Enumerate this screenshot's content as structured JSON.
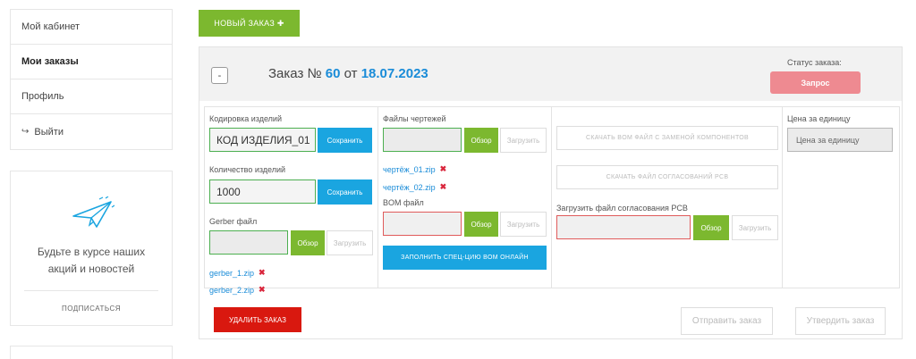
{
  "sidebar": {
    "items": [
      {
        "label": "Мой кабинет"
      },
      {
        "label": "Мои заказы"
      },
      {
        "label": "Профиль"
      },
      {
        "label": "Выйти"
      }
    ],
    "subscribe": {
      "text": "Будьте в курсе наших акций и новостей",
      "link": "ПОДПИСАТЬСЯ"
    }
  },
  "toolbar": {
    "new_order": "НОВЫЙ ЗАКАЗ ✚"
  },
  "order": {
    "collapse": "-",
    "title_prefix": "Заказ №",
    "number": "60",
    "date_prefix": "от",
    "date": "18.07.2023",
    "status_label": "Статус заказа:",
    "status": "Запрос",
    "encoding": {
      "label": "Кодировка изделий",
      "value": "КОД ИЗДЕЛИЯ_01",
      "save": "Сохранить"
    },
    "quantity": {
      "label": "Количество изделий",
      "value": "1000",
      "save": "Сохранить"
    },
    "gerber": {
      "label": "Gerber файл",
      "browse": "Обзор",
      "upload": "Загрузить",
      "files": [
        "gerber_1.zip",
        "gerber_2.zip"
      ]
    },
    "drawings": {
      "label": "Файлы чертежей",
      "browse": "Обзор",
      "upload": "Загрузить",
      "files": [
        "чертёж_01.zip",
        "чертёж_02.zip"
      ]
    },
    "bom": {
      "label": "BOM файл",
      "browse": "Обзор",
      "upload": "Загрузить",
      "fill_online": "ЗАПОЛНИТЬ СПЕЦ-ЦИЮ BOM ОНЛАЙН"
    },
    "downloads": {
      "bom_replaced": "СКАЧАТЬ BOM ФАЙЛ С ЗАМЕНОЙ КОМПОНЕНТОВ",
      "pcb_approval": "СКАЧАТЬ ФАЙЛ СОГЛАСОВАНИЙ PCB"
    },
    "pcb_upload": {
      "label": "Загрузить файл согласования PCB",
      "browse": "Обзор",
      "upload": "Загрузить"
    },
    "unit_price": {
      "label": "Цена за единицу",
      "placeholder": "Цена за единицу"
    },
    "actions": {
      "delete": "УДАЛИТЬ ЗАКАЗ",
      "send": "Отправить заказ",
      "approve": "Утвердить заказ"
    }
  },
  "colors": {
    "accent_green": "#7cb82f",
    "accent_blue": "#1aa5e0",
    "status_pink": "#ee8a91",
    "danger": "#d9180f"
  }
}
